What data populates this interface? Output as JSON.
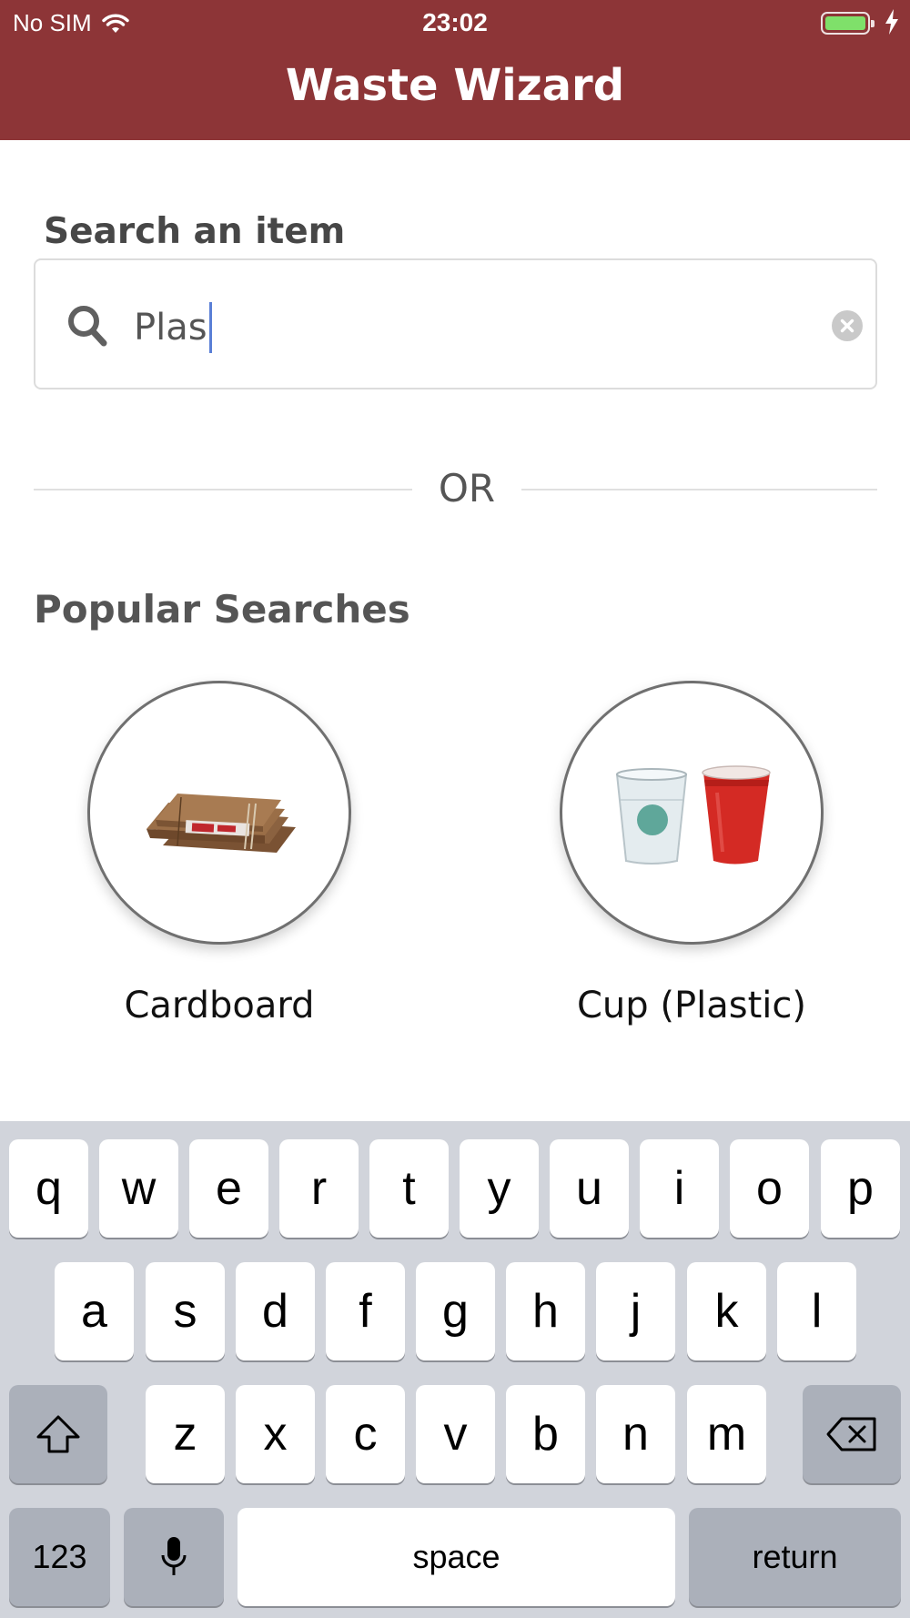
{
  "status_bar": {
    "carrier": "No SIM",
    "time": "23:02",
    "icons": [
      "wifi-icon",
      "battery-icon",
      "charging-bolt-icon"
    ]
  },
  "header": {
    "title": "Waste Wizard",
    "background": "#8d3537"
  },
  "search": {
    "label": "Search an item",
    "value": "Plas",
    "icons": [
      "search-icon",
      "clear-icon"
    ]
  },
  "divider": {
    "text": "OR"
  },
  "popular": {
    "title": "Popular Searches",
    "items": [
      {
        "label": "Cardboard",
        "image": "cardboard-image"
      },
      {
        "label": "Cup (Plastic)",
        "image": "plastic-cups-image"
      }
    ]
  },
  "keyboard": {
    "row1": [
      "q",
      "w",
      "e",
      "r",
      "t",
      "y",
      "u",
      "i",
      "o",
      "p"
    ],
    "row2": [
      "a",
      "s",
      "d",
      "f",
      "g",
      "h",
      "j",
      "k",
      "l"
    ],
    "row3": [
      "z",
      "x",
      "c",
      "v",
      "b",
      "n",
      "m"
    ],
    "numbers_label": "123",
    "space_label": "space",
    "return_label": "return",
    "icons": [
      "shift-icon",
      "backspace-icon",
      "microphone-icon"
    ]
  }
}
